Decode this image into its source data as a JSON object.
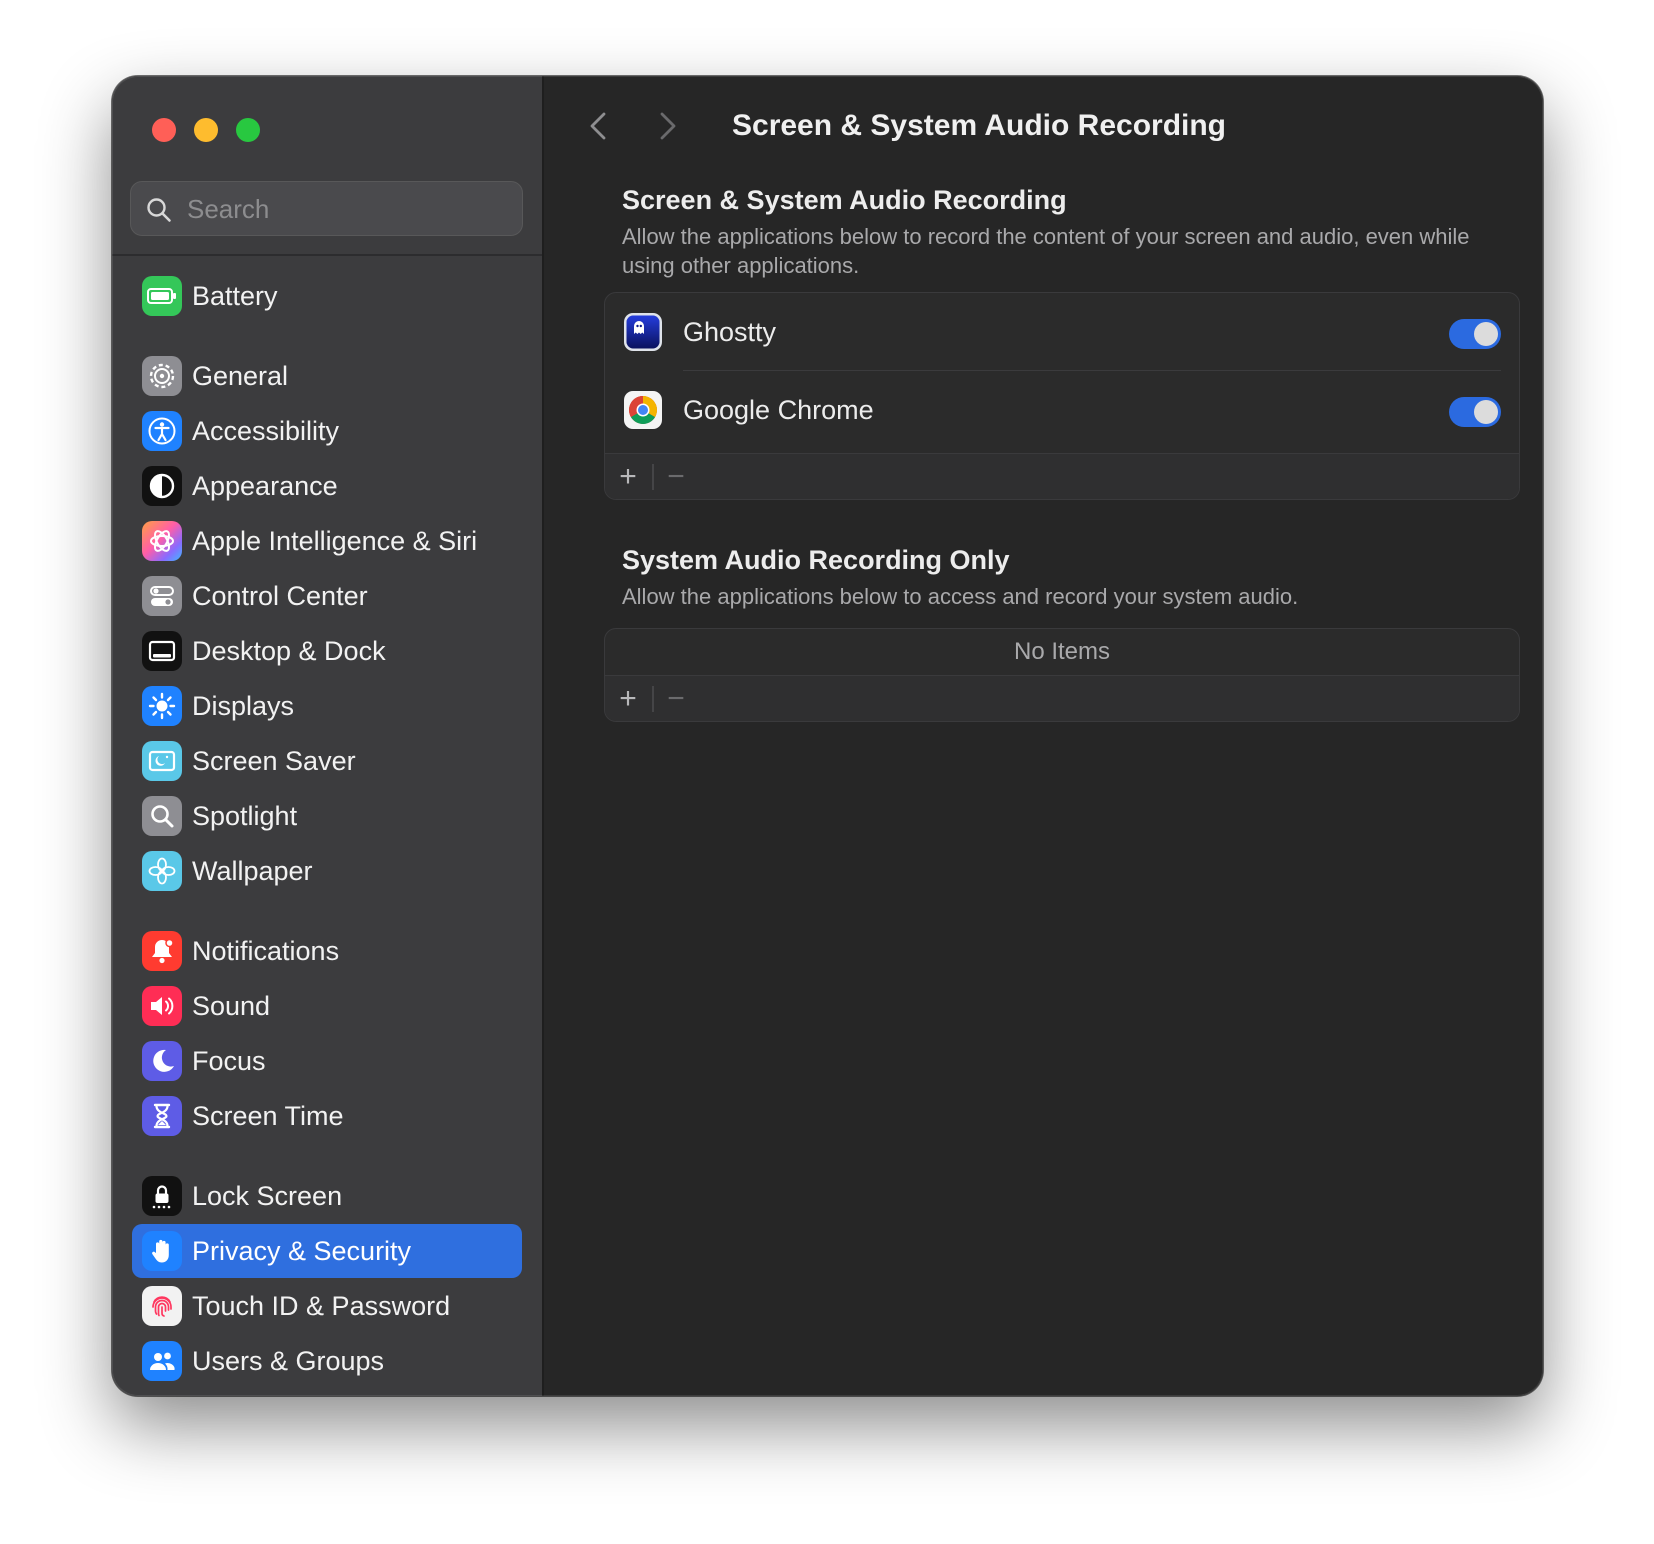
{
  "window": {
    "title": "Screen & System Audio Recording"
  },
  "search": {
    "placeholder": "Search"
  },
  "sidebar": {
    "items": [
      {
        "label": "Battery"
      },
      {
        "label": "General"
      },
      {
        "label": "Accessibility"
      },
      {
        "label": "Appearance"
      },
      {
        "label": "Apple Intelligence & Siri"
      },
      {
        "label": "Control Center"
      },
      {
        "label": "Desktop & Dock"
      },
      {
        "label": "Displays"
      },
      {
        "label": "Screen Saver"
      },
      {
        "label": "Spotlight"
      },
      {
        "label": "Wallpaper"
      },
      {
        "label": "Notifications"
      },
      {
        "label": "Sound"
      },
      {
        "label": "Focus"
      },
      {
        "label": "Screen Time"
      },
      {
        "label": "Lock Screen"
      },
      {
        "label": "Privacy & Security"
      },
      {
        "label": "Touch ID & Password"
      },
      {
        "label": "Users & Groups"
      }
    ],
    "selected": "Privacy & Security"
  },
  "screen_recording": {
    "title": "Screen & System Audio Recording",
    "description": "Allow the applications below to record the content of your screen and audio, even while using other applications.",
    "apps": [
      {
        "name": "Ghostty",
        "enabled": true
      },
      {
        "name": "Google Chrome",
        "enabled": true
      }
    ],
    "add_label": "+",
    "remove_label": "−"
  },
  "audio_only": {
    "title": "System Audio Recording Only",
    "description": "Allow the applications below to access and record your system audio.",
    "empty_text": "No Items",
    "add_label": "+",
    "remove_label": "−"
  },
  "colors": {
    "accent": "#2f6fdf",
    "toggle_on": "#2b6ae0"
  }
}
